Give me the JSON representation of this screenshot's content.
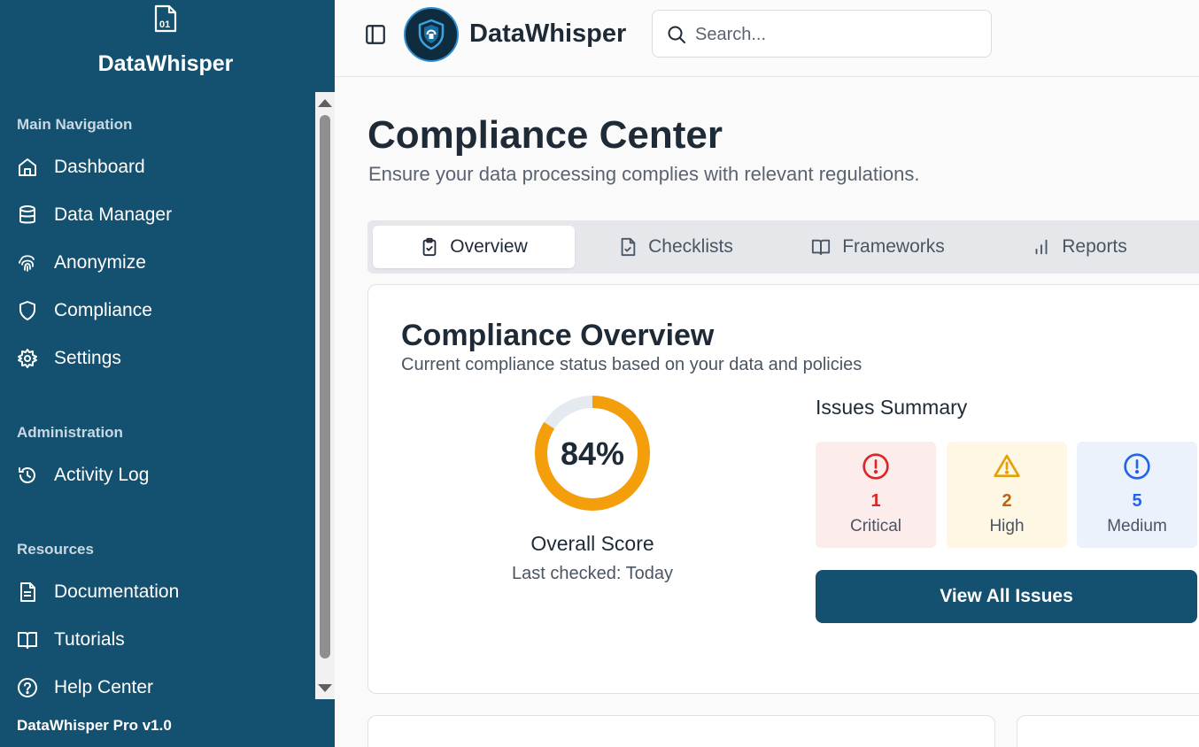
{
  "sidebar": {
    "brand": "DataWhisper",
    "sections": {
      "main_navigation": "Main Navigation",
      "administration": "Administration",
      "resources": "Resources"
    },
    "items": [
      {
        "label": "Dashboard",
        "icon": "home-icon"
      },
      {
        "label": "Data Manager",
        "icon": "database-icon"
      },
      {
        "label": "Anonymize",
        "icon": "fingerprint-icon"
      },
      {
        "label": "Compliance",
        "icon": "shield-icon"
      },
      {
        "label": "Settings",
        "icon": "gear-icon"
      },
      {
        "label": "Activity Log",
        "icon": "history-icon"
      },
      {
        "label": "Documentation",
        "icon": "document-icon"
      },
      {
        "label": "Tutorials",
        "icon": "book-icon"
      },
      {
        "label": "Help Center",
        "icon": "help-icon"
      }
    ],
    "version": "DataWhisper Pro v1.0"
  },
  "header": {
    "title": "DataWhisper",
    "search_placeholder": "Search..."
  },
  "main": {
    "title": "Compliance Center",
    "subtitle": "Ensure your data processing complies with relevant regulations.",
    "tabs": [
      {
        "label": "Overview",
        "icon": "clipboard-check-icon",
        "active": true
      },
      {
        "label": "Checklists",
        "icon": "file-check-icon",
        "active": false
      },
      {
        "label": "Frameworks",
        "icon": "book-open-icon",
        "active": false
      },
      {
        "label": "Reports",
        "icon": "bar-chart-icon",
        "active": false
      }
    ],
    "overview": {
      "title": "Compliance Overview",
      "subtitle": "Current compliance status based on your data and policies",
      "score_value": "84%",
      "score_fraction": 0.84,
      "score_label": "Overall Score",
      "last_checked": "Last checked: Today",
      "issues_title": "Issues Summary",
      "issues": [
        {
          "count": "1",
          "label": "Critical",
          "color": "#dc2626"
        },
        {
          "count": "2",
          "label": "High",
          "color": "#c2610c"
        },
        {
          "count": "5",
          "label": "Medium",
          "color": "#2563eb"
        }
      ],
      "view_all_label": "View All Issues"
    }
  },
  "colors": {
    "sidebar_bg": "#14506f",
    "accent": "#14506f",
    "gauge": "#f59e0b",
    "gauge_track": "#e5e9f0"
  }
}
